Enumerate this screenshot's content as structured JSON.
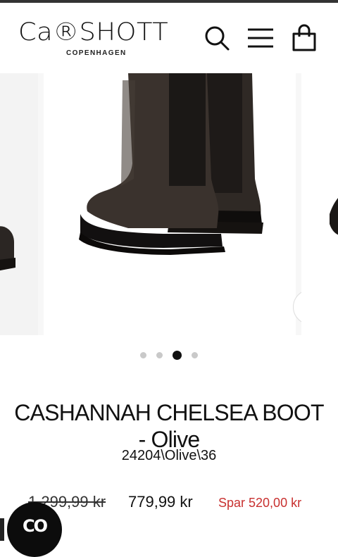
{
  "header": {
    "logo_main": "Ca®SHOTT",
    "logo_sub": "COPENHAGEN",
    "icons": [
      "search-icon",
      "menu-icon",
      "cart-icon"
    ]
  },
  "gallery": {
    "slide_count": 4,
    "active_slide": 3,
    "zoom_icon": "zoom-in-icon"
  },
  "product": {
    "title": "CASHANNAH CHELSEA BOOT - Olive",
    "sku": "24204\\Olive\\36",
    "old_price": "1.299,99 kr",
    "new_price": "779,99 kr",
    "savings": "Spar 520,00 kr"
  },
  "chat": {
    "label": "CO",
    "icon": "chat-badge-icon"
  },
  "colors": {
    "accent_sale": "#c8302f",
    "text": "#111111",
    "dot_active": "#111111",
    "dot_inactive": "#c9c9c9"
  }
}
